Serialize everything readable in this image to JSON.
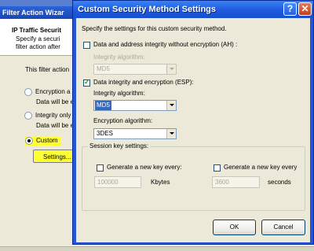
{
  "background_window": {
    "title": "Filter Action Wizar",
    "header_title": "IP Traffic Securit",
    "header_description": [
      "Specify a securi",
      "filter action after"
    ],
    "intro_text": "This filter action",
    "options": [
      {
        "label": "Encryption a",
        "description": "Data will be e",
        "selected": false
      },
      {
        "label": "Integrity only",
        "description": "Data will be e",
        "selected": false
      },
      {
        "label": "Custom",
        "selected": true
      }
    ],
    "settings_button": "Settings..."
  },
  "dialog": {
    "title": "Custom Security Method Settings",
    "help_label": "?",
    "close_label": "✕",
    "instructions": "Specify the settings for this custom security method.",
    "ah": {
      "label": "Data and address integrity without encryption (AH) :",
      "checked": false,
      "integrity_label": "Integrity algorithm:",
      "integrity_value": "MD5"
    },
    "esp": {
      "label": "Data integrity and encryption (ESP):",
      "checked": true,
      "integrity_label": "Integrity algorithm:",
      "integrity_value": "MD5",
      "encryption_label": "Encryption algorithm:",
      "encryption_value": "3DES"
    },
    "session_key": {
      "legend": "Session key settings:",
      "kbytes_check_label": "Generate a new key every:",
      "kbytes_value": "100000",
      "kbytes_unit": "Kbytes",
      "seconds_check_label": "Generate a new key every",
      "seconds_value": "3600",
      "seconds_unit": "seconds"
    },
    "ok_label": "OK",
    "cancel_label": "Cancel"
  },
  "colors": {
    "titlebar": "#1e5ae0",
    "dialog_bg": "#ece9d8",
    "highlight": "#ffff33",
    "selection": "#316ac5"
  }
}
